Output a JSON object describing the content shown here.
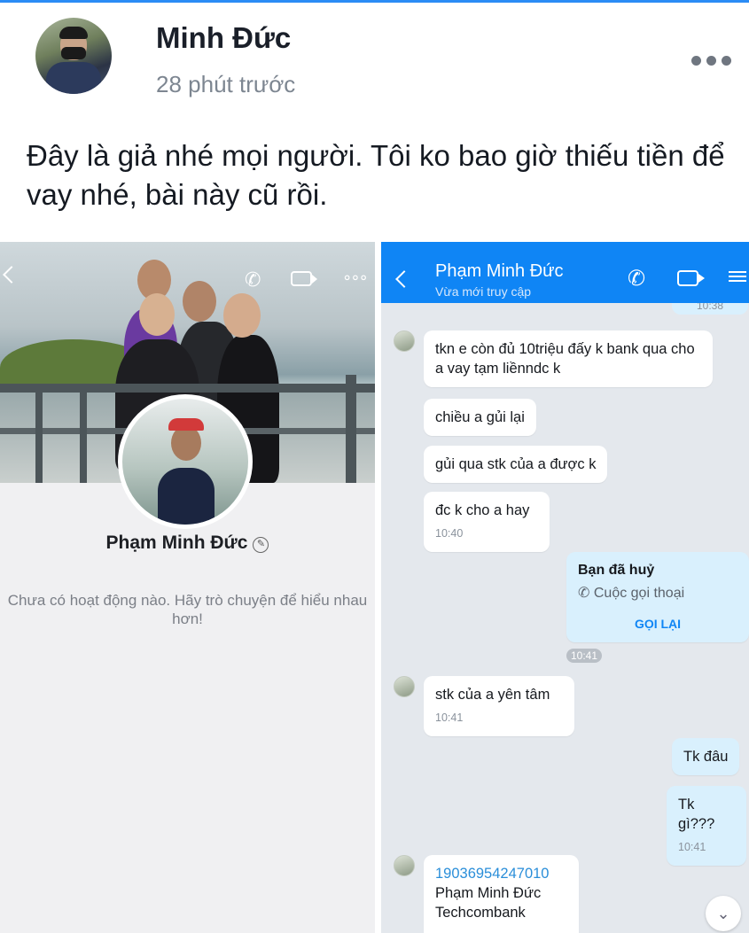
{
  "post": {
    "author": "Minh Đức",
    "time_ago": "28 phút trước",
    "text": "Đây là giả nhé mọi người. Tôi ko bao giờ thiếu tiền để vay nhé, bài này cũ rồi."
  },
  "profile": {
    "name": "Phạm Minh Đức",
    "empty_note": "Chưa có hoạt động nào. Hãy trò chuyện để hiểu nhau hơn!"
  },
  "chat": {
    "contact_name": "Phạm Minh Đức",
    "status": "Vừa mới truy cập",
    "prev_time": "10:38",
    "messages": [
      {
        "from": "them",
        "text": "tkn e còn đủ 10triệu đấy k bank qua cho a vay tạm liềnndc k"
      },
      {
        "from": "them",
        "text": "chiều a gủi lại"
      },
      {
        "from": "them",
        "text": "gủi qua stk của a được k"
      },
      {
        "from": "them",
        "text": "đc k cho a hay",
        "time": "10:40"
      },
      {
        "from": "me",
        "type": "call",
        "title": "Bạn đã huỷ",
        "sub": "Cuộc gọi thoại",
        "action": "GỌI LẠI",
        "time": "10:41"
      },
      {
        "from": "them",
        "text": "stk của a yên tâm",
        "time": "10:41"
      },
      {
        "from": "me",
        "text": "Tk đâu"
      },
      {
        "from": "me",
        "text": "Tk gì???",
        "time": "10:41"
      },
      {
        "from": "them",
        "account": "19036954247010",
        "name": "Phạm Minh Đức",
        "bank": "Techcombank"
      }
    ]
  },
  "icons": [
    "more-icon",
    "back-icon",
    "phone-icon",
    "video-icon",
    "menu-icon",
    "edit-icon",
    "chevron-down-icon"
  ]
}
